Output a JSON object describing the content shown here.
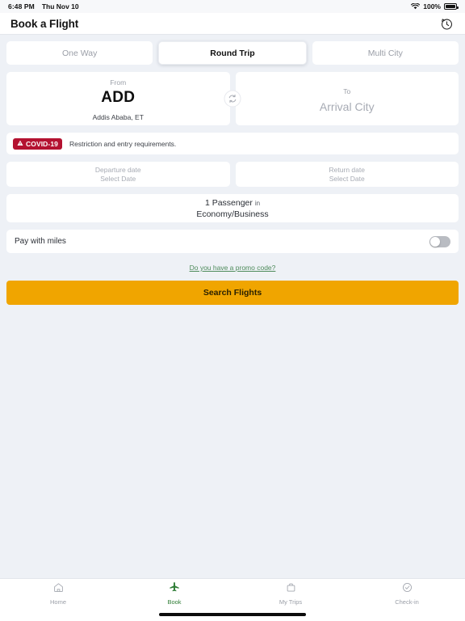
{
  "status_bar": {
    "time": "6:48 PM",
    "date": "Thu Nov 10",
    "battery_percent": "100%",
    "wifi_icon": "wifi-icon",
    "battery_icon": "battery-full-icon"
  },
  "header": {
    "title": "Book a Flight",
    "history_icon": "history-clock-icon"
  },
  "trip_tabs": [
    {
      "label": "One Way",
      "selected": false
    },
    {
      "label": "Round Trip",
      "selected": true
    },
    {
      "label": "Multi City",
      "selected": false
    }
  ],
  "route": {
    "from": {
      "label": "From",
      "code": "ADD",
      "city": "Addis Ababa, ET"
    },
    "to": {
      "label": "To",
      "placeholder": "Arrival City"
    },
    "swap_icon": "swap-refresh-icon"
  },
  "covid": {
    "badge": "COVID-19",
    "badge_icon": "warning-triangle-icon",
    "message": "Restriction and entry requirements."
  },
  "dates": {
    "departure": {
      "label": "Departure date",
      "value": "Select Date"
    },
    "return": {
      "label": "Return date",
      "value": "Select Date"
    }
  },
  "passengers": {
    "count_text": "1 Passenger",
    "connector": "in",
    "cabin": "Economy/Business"
  },
  "miles": {
    "label": "Pay with miles",
    "toggle_state": "off"
  },
  "promo": {
    "link_text": "Do you have a promo code?"
  },
  "search": {
    "label": "Search Flights"
  },
  "bottom_tabs": [
    {
      "label": "Home",
      "icon": "home-icon",
      "active": false
    },
    {
      "label": "Book",
      "icon": "airplane-icon",
      "active": true
    },
    {
      "label": "My Trips",
      "icon": "suitcase-icon",
      "active": false
    },
    {
      "label": "Check-in",
      "icon": "check-circle-icon",
      "active": false
    }
  ],
  "colors": {
    "background": "#eef1f6",
    "accent_button": "#f0a500",
    "covid_badge": "#b41231",
    "active_tab": "#2f7d36",
    "promo_link": "#4e8b5b"
  }
}
